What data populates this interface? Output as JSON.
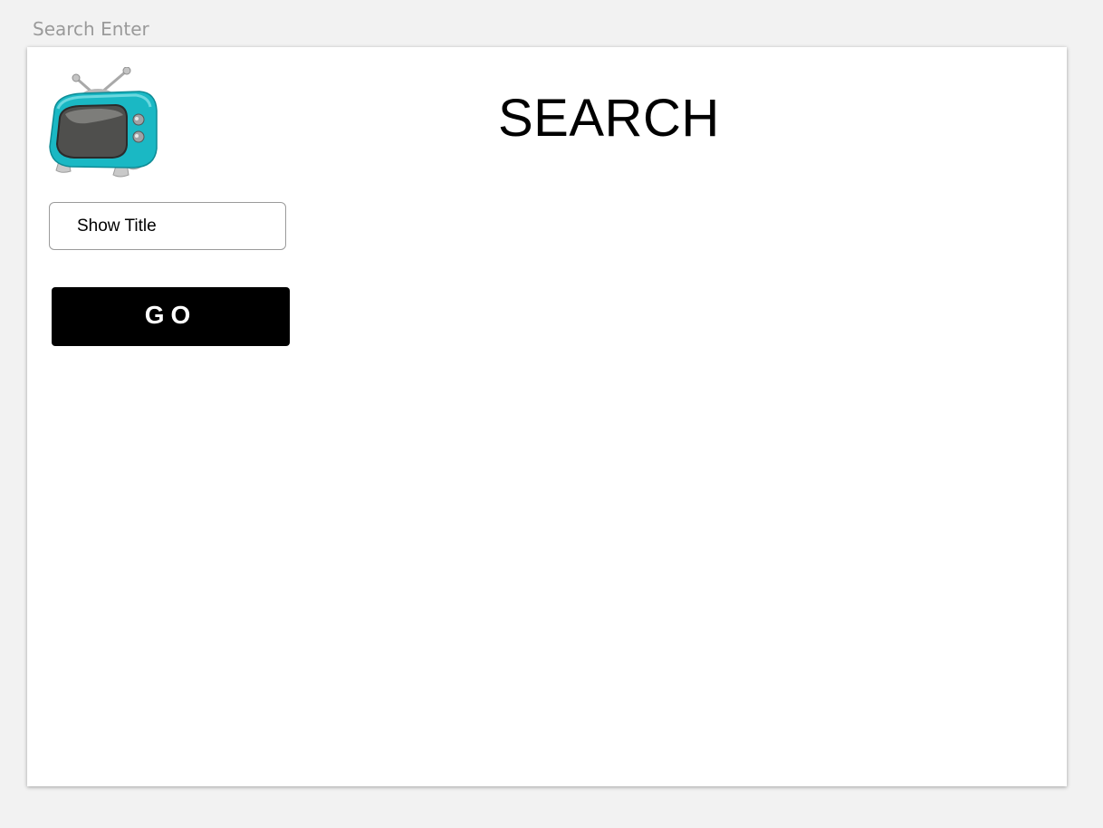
{
  "artboard": {
    "label": "Search Enter"
  },
  "header": {
    "title": "SEARCH",
    "logo_icon": "retro-tv-icon"
  },
  "search": {
    "placeholder": "Show Title"
  },
  "actions": {
    "go_label": "GO"
  },
  "colors": {
    "tv_body": "#1ab8c4",
    "button_bg": "#000000",
    "button_text": "#ffffff"
  }
}
